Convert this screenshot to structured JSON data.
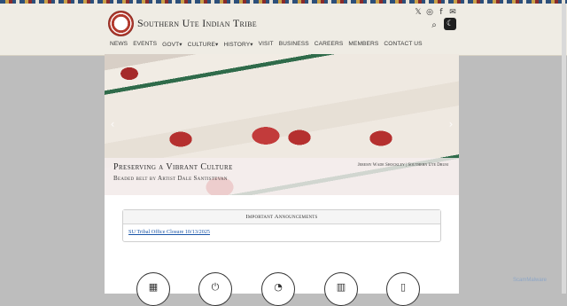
{
  "site": {
    "title": "Southern Ute Indian Tribe"
  },
  "social": [
    {
      "name": "x-icon",
      "glyph": "𝕏"
    },
    {
      "name": "instagram-icon",
      "glyph": "◎"
    },
    {
      "name": "facebook-icon",
      "glyph": "f"
    },
    {
      "name": "email-icon",
      "glyph": "✉"
    }
  ],
  "header": {
    "search_glyph": "⌕",
    "dark_mode_glyph": "☾"
  },
  "nav": [
    "NEWS",
    "EVENTS",
    "GOVT▾",
    "CULTURE▾",
    "HISTORY▾",
    "VISIT",
    "BUSINESS",
    "CAREERS",
    "MEMBERS",
    "CONTACT US"
  ],
  "hero": {
    "title": "Preserving a Vibrant Culture",
    "subtitle": "Beaded belt by Artist Dale Santistevan",
    "credit": "Jeremy Wade Shockley | Southern Ute Drum",
    "prev_glyph": "‹",
    "next_glyph": "›"
  },
  "announcements": {
    "heading": "Important Announcements",
    "items": [
      "SU Tribal Office Closure 10/13/2025"
    ]
  },
  "quick_links": [
    {
      "name": "calculator-icon",
      "glyph": "▦"
    },
    {
      "name": "plug-icon",
      "glyph": "⏻"
    },
    {
      "name": "gauge-icon",
      "glyph": "◔"
    },
    {
      "name": "building-icon",
      "glyph": "▥"
    },
    {
      "name": "book-icon",
      "glyph": "▯"
    }
  ],
  "watermark": "ScamMalware"
}
